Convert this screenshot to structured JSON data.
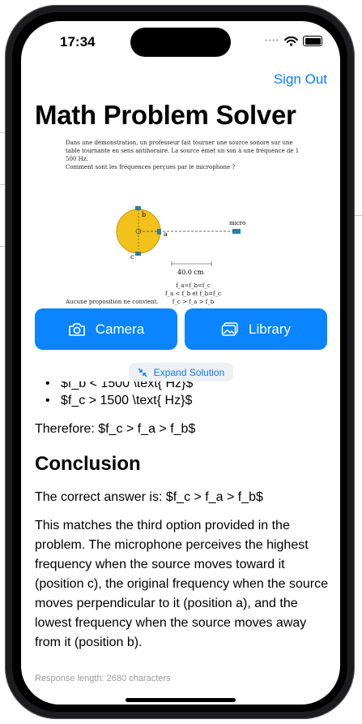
{
  "status_bar": {
    "time": "17:34",
    "signal": "••••"
  },
  "header": {
    "sign_out": "Sign Out",
    "title": "Math Problem Solver"
  },
  "problem_image": {
    "text_line1": "Dans une démonstration, un professeur fait tourner une source sonore sur une",
    "text_line2": "table tournante en sens antihoraire. La source émet un son à une fréquence de 1",
    "text_line3": "500 Hz.",
    "question": "Comment sont les fréquences perçues par le microphone ?",
    "label_b": "b",
    "label_a": "a",
    "label_c": "c",
    "label_micro": "micro",
    "distance": "40.0 cm",
    "option1": "f_a=f_b=f_c",
    "option2": "f_a < f_b et f_b=f_c",
    "option3": "f_c > f_a > f_b",
    "footer_text": "Aucune proposition ne convient."
  },
  "buttons": {
    "camera": "Camera",
    "library": "Library",
    "expand": "Expand Solution"
  },
  "solution": {
    "cut_line": "$f_b < 1500 \\text{ Hz}$",
    "bullet": "$f_c > 1500 \\text{ Hz}$",
    "therefore": "Therefore: $f_c > f_a > f_b$",
    "conclusion_heading": "Conclusion",
    "answer": "The correct answer is: $f_c > f_a > f_b$",
    "explanation": "This matches the third option provided in the problem. The microphone perceives the highest frequency when the source moves toward it (position c), the original frequency when the source moves perpendicular to it (position a), and the lowest frequency when the source moves away from it (position b)."
  },
  "footer": {
    "response_length": "Response length: 2680 characters"
  },
  "colors": {
    "accent": "#0a84ff",
    "link": "#0a7cff",
    "disk": "#f2c21b"
  }
}
